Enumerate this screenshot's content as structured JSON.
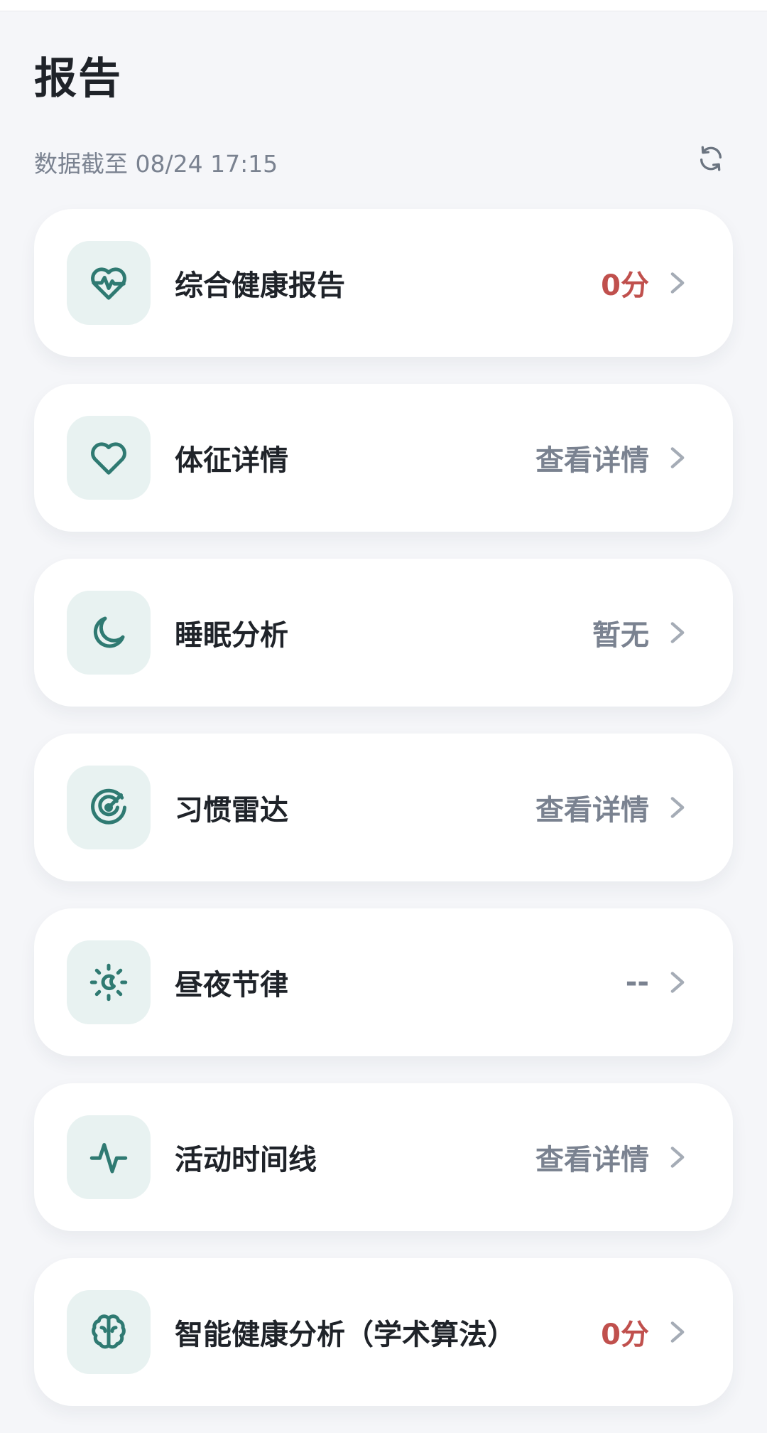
{
  "page": {
    "title": "报告",
    "updated_label": "数据截至 08/24 17:15"
  },
  "colors": {
    "accent": "#2f7a72",
    "icon_bg": "#e8f2f1",
    "value_red": "#c0504d",
    "value_gray": "#7a8290"
  },
  "reports": [
    {
      "label": "综合健康报告",
      "value": "0分",
      "icon": "heart-pulse-icon"
    },
    {
      "label": "体征详情",
      "value": "查看详情",
      "icon": "heart-icon"
    },
    {
      "label": "睡眠分析",
      "value": "暂无",
      "icon": "moon-icon"
    },
    {
      "label": "习惯雷达",
      "value": "查看详情",
      "icon": "radar-icon"
    },
    {
      "label": "昼夜节律",
      "value": "--",
      "icon": "sun-moon-icon"
    },
    {
      "label": "活动时间线",
      "value": "查看详情",
      "icon": "activity-icon"
    },
    {
      "label": "智能健康分析（学术算法）",
      "value": "0分",
      "icon": "brain-icon"
    }
  ]
}
